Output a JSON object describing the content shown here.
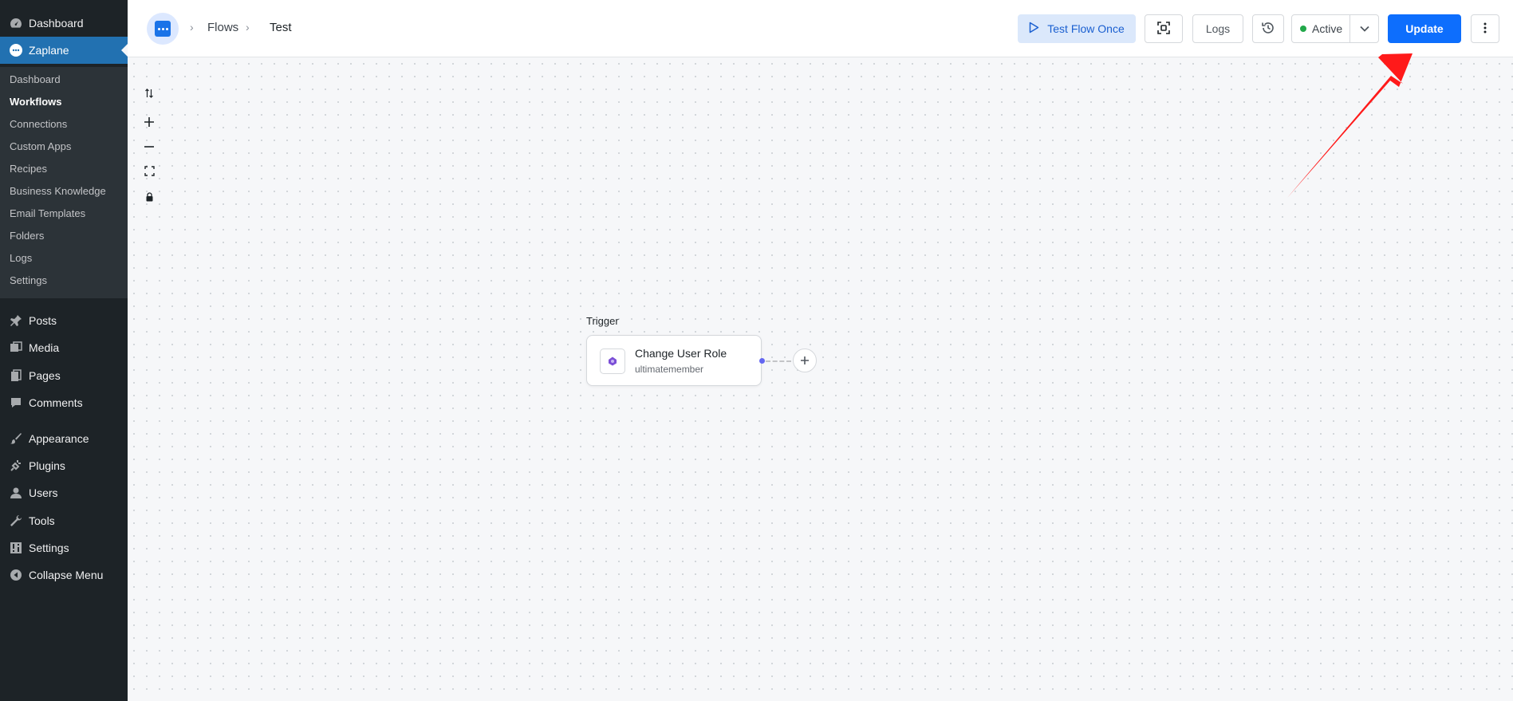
{
  "sidebar": {
    "top_items": [
      {
        "label": "Dashboard",
        "icon": "dashboard-icon"
      },
      {
        "label": "Zaplane",
        "icon": "zaplane-icon"
      }
    ],
    "submenu": [
      "Dashboard",
      "Workflows",
      "Connections",
      "Custom Apps",
      "Recipes",
      "Business Knowledge",
      "Email Templates",
      "Folders",
      "Logs",
      "Settings"
    ],
    "submenu_current": "Workflows",
    "items": [
      {
        "label": "Posts",
        "icon": "pin-icon"
      },
      {
        "label": "Media",
        "icon": "media-icon"
      },
      {
        "label": "Pages",
        "icon": "pages-icon"
      },
      {
        "label": "Comments",
        "icon": "comment-icon"
      },
      {
        "label": "Appearance",
        "icon": "brush-icon"
      },
      {
        "label": "Plugins",
        "icon": "plug-icon"
      },
      {
        "label": "Users",
        "icon": "user-icon"
      },
      {
        "label": "Tools",
        "icon": "wrench-icon"
      },
      {
        "label": "Settings",
        "icon": "sliders-icon"
      },
      {
        "label": "Collapse Menu",
        "icon": "collapse-icon"
      }
    ]
  },
  "topbar": {
    "breadcrumb": [
      "Flows",
      "Test"
    ],
    "test_flow_label": "Test Flow Once",
    "logs_label": "Logs",
    "status_label": "Active",
    "update_label": "Update"
  },
  "canvas": {
    "trigger_label": "Trigger",
    "node": {
      "title": "Change User Role",
      "subtitle": "ultimatemember"
    }
  },
  "colors": {
    "wp_sidebar": "#1d2327",
    "wp_active": "#2271b1",
    "update_button": "#0d6efd",
    "status_dot": "#22a84a",
    "annotation_arrow": "#ff1a1a"
  }
}
